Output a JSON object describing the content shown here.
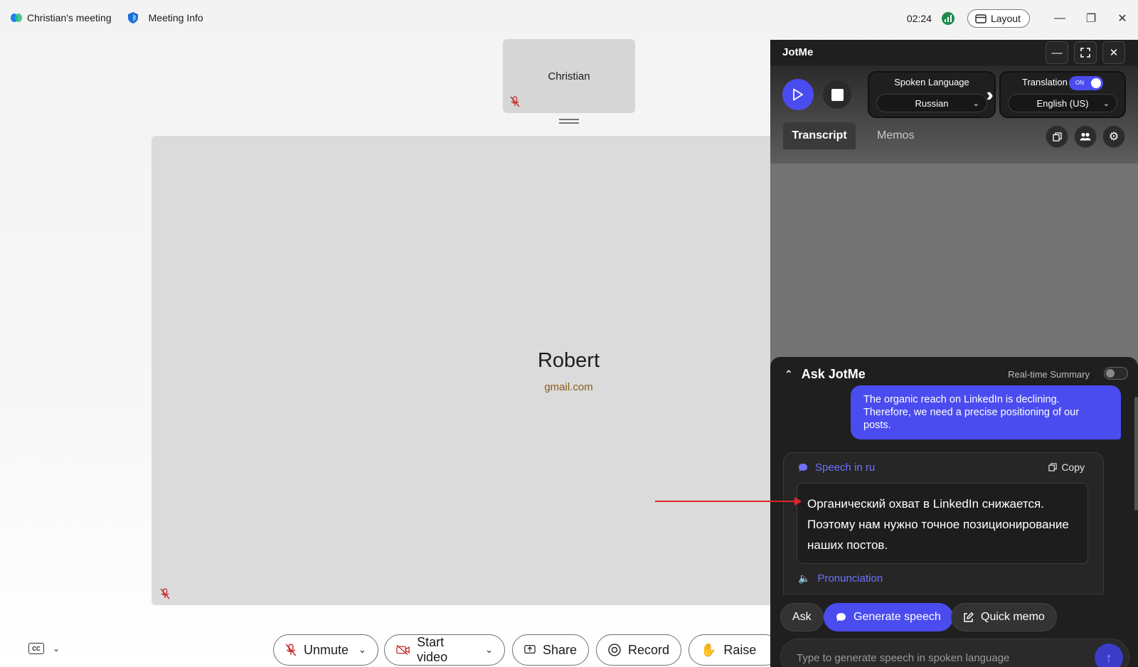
{
  "titlebar": {
    "meeting_title": "Christian's meeting",
    "meeting_info": "Meeting Info",
    "clock": "02:24",
    "layout_label": "Layout"
  },
  "stage": {
    "thumbnail_name": "Christian",
    "main_name": "Robert",
    "main_email": "gmail.com"
  },
  "toolbar": {
    "unmute": "Unmute",
    "start_video": "Start video",
    "share": "Share",
    "record": "Record",
    "raise": "Raise",
    "cc_label": "CC"
  },
  "jotme": {
    "title": "JotMe",
    "spoken_language_label": "Spoken Language",
    "spoken_language_value": "Russian",
    "translation_label": "Translation",
    "translation_toggle": "ON",
    "translation_value": "English (US)",
    "tabs": [
      {
        "label": "Transcript"
      },
      {
        "label": "Memos"
      }
    ],
    "ask": {
      "title": "Ask JotMe",
      "realtime_summary_label": "Real-time Summary",
      "user_message": "The organic reach on LinkedIn is declining. Therefore, we need a precise positioning of our posts.",
      "card_title": "Speech in ru",
      "copy_label": "Copy",
      "speech_text": "Органический охват в LinkedIn снижается. Поэтому нам нужно точное позиционирование наших постов.",
      "pronunciation_label": "Pronunciation",
      "actions": {
        "ask": "Ask",
        "generate_speech": "Generate speech",
        "quick_memo": "Quick memo"
      },
      "input_placeholder": "Type to generate speech in spoken language"
    }
  },
  "colors": {
    "accent": "#4a4cf0",
    "annotation_arrow": "#e0262a",
    "mic_off": "#c62828"
  }
}
